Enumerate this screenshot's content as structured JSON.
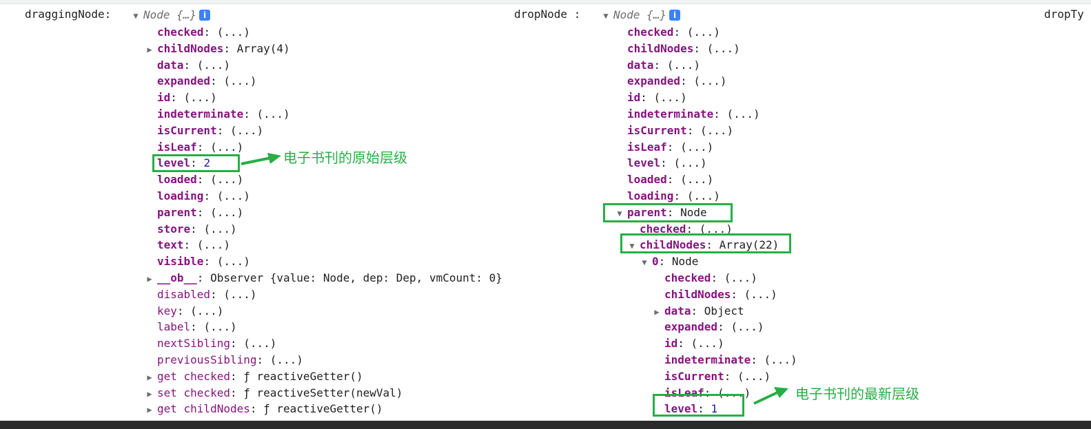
{
  "left": {
    "label": "draggingNode:",
    "summary": "Node {…}",
    "rows": [
      {
        "k": "checked",
        "v": "(...)",
        "t": ""
      },
      {
        "k": "childNodes",
        "v": "Array(4)",
        "t": "r"
      },
      {
        "k": "data",
        "v": "(...)",
        "t": ""
      },
      {
        "k": "expanded",
        "v": "(...)",
        "t": ""
      },
      {
        "k": "id",
        "v": "(...)",
        "t": ""
      },
      {
        "k": "indeterminate",
        "v": "(...)",
        "t": ""
      },
      {
        "k": "isCurrent",
        "v": "(...)",
        "t": ""
      },
      {
        "k": "isLeaf",
        "v": "(...)",
        "t": ""
      },
      {
        "k": "level",
        "v": "2",
        "t": "",
        "num": true
      },
      {
        "k": "loaded",
        "v": "(...)",
        "t": ""
      },
      {
        "k": "loading",
        "v": "(...)",
        "t": ""
      },
      {
        "k": "parent",
        "v": "(...)",
        "t": ""
      },
      {
        "k": "store",
        "v": "(...)",
        "t": ""
      },
      {
        "k": "text",
        "v": "(...)",
        "t": ""
      },
      {
        "k": "visible",
        "v": "(...)",
        "t": ""
      },
      {
        "k": "__ob__",
        "v": "Observer {value: Node, dep: Dep, vmCount: 0}",
        "t": "r"
      },
      {
        "k": "disabled",
        "v": "(...)",
        "t": "",
        "np": true
      },
      {
        "k": "key",
        "v": "(...)",
        "t": "",
        "np": true
      },
      {
        "k": "label",
        "v": "(...)",
        "t": "",
        "np": true
      },
      {
        "k": "nextSibling",
        "v": "(...)",
        "t": "",
        "np": true
      },
      {
        "k": "previousSibling",
        "v": "(...)",
        "t": "",
        "np": true
      },
      {
        "k": "get checked",
        "v": "ƒ reactiveGetter()",
        "t": "r",
        "np": true
      },
      {
        "k": "set checked",
        "v": "ƒ reactiveSetter(newVal)",
        "t": "r",
        "np": true
      },
      {
        "k": "get childNodes",
        "v": "ƒ reactiveGetter()",
        "t": "r",
        "np": true
      }
    ],
    "note": "电子书刊的原始层级"
  },
  "right": {
    "label": "dropNode :",
    "summary": "Node {…}",
    "rows": [
      {
        "k": "checked",
        "v": "(...)",
        "t": "",
        "d": 0
      },
      {
        "k": "childNodes",
        "v": "(...)",
        "t": "",
        "d": 0
      },
      {
        "k": "data",
        "v": "(...)",
        "t": "",
        "d": 0
      },
      {
        "k": "expanded",
        "v": "(...)",
        "t": "",
        "d": 0
      },
      {
        "k": "id",
        "v": "(...)",
        "t": "",
        "d": 0
      },
      {
        "k": "indeterminate",
        "v": "(...)",
        "t": "",
        "d": 0
      },
      {
        "k": "isCurrent",
        "v": "(...)",
        "t": "",
        "d": 0
      },
      {
        "k": "isLeaf",
        "v": "(...)",
        "t": "",
        "d": 0
      },
      {
        "k": "level",
        "v": "(...)",
        "t": "",
        "d": 0
      },
      {
        "k": "loaded",
        "v": "(...)",
        "t": "",
        "d": 0
      },
      {
        "k": "loading",
        "v": "(...)",
        "t": "",
        "d": 0
      },
      {
        "k": "parent",
        "v": "Node",
        "t": "d",
        "d": 0
      },
      {
        "k": "checked",
        "v": "(...)",
        "t": "",
        "d": 1
      },
      {
        "k": "childNodes",
        "v": "Array(22)",
        "t": "d",
        "d": 1
      },
      {
        "k": "0",
        "v": "Node",
        "t": "d",
        "d": 2
      },
      {
        "k": "checked",
        "v": "(...)",
        "t": "",
        "d": 3
      },
      {
        "k": "childNodes",
        "v": "(...)",
        "t": "",
        "d": 3
      },
      {
        "k": "data",
        "v": "Object",
        "t": "r",
        "d": 3
      },
      {
        "k": "expanded",
        "v": "(...)",
        "t": "",
        "d": 3
      },
      {
        "k": "id",
        "v": "(...)",
        "t": "",
        "d": 3
      },
      {
        "k": "indeterminate",
        "v": "(...)",
        "t": "",
        "d": 3
      },
      {
        "k": "isCurrent",
        "v": "(...)",
        "t": "",
        "d": 3
      },
      {
        "k": "isLeaf",
        "v": "(...)",
        "t": "",
        "d": 3
      },
      {
        "k": "level",
        "v": "1",
        "t": "",
        "d": 3,
        "num": true
      }
    ],
    "note": "电子书刊的最新层级"
  },
  "third_label": "dropTy",
  "colors": {
    "annotation": "#27ae45",
    "key": "#881280",
    "number": "#1a1aa6"
  }
}
